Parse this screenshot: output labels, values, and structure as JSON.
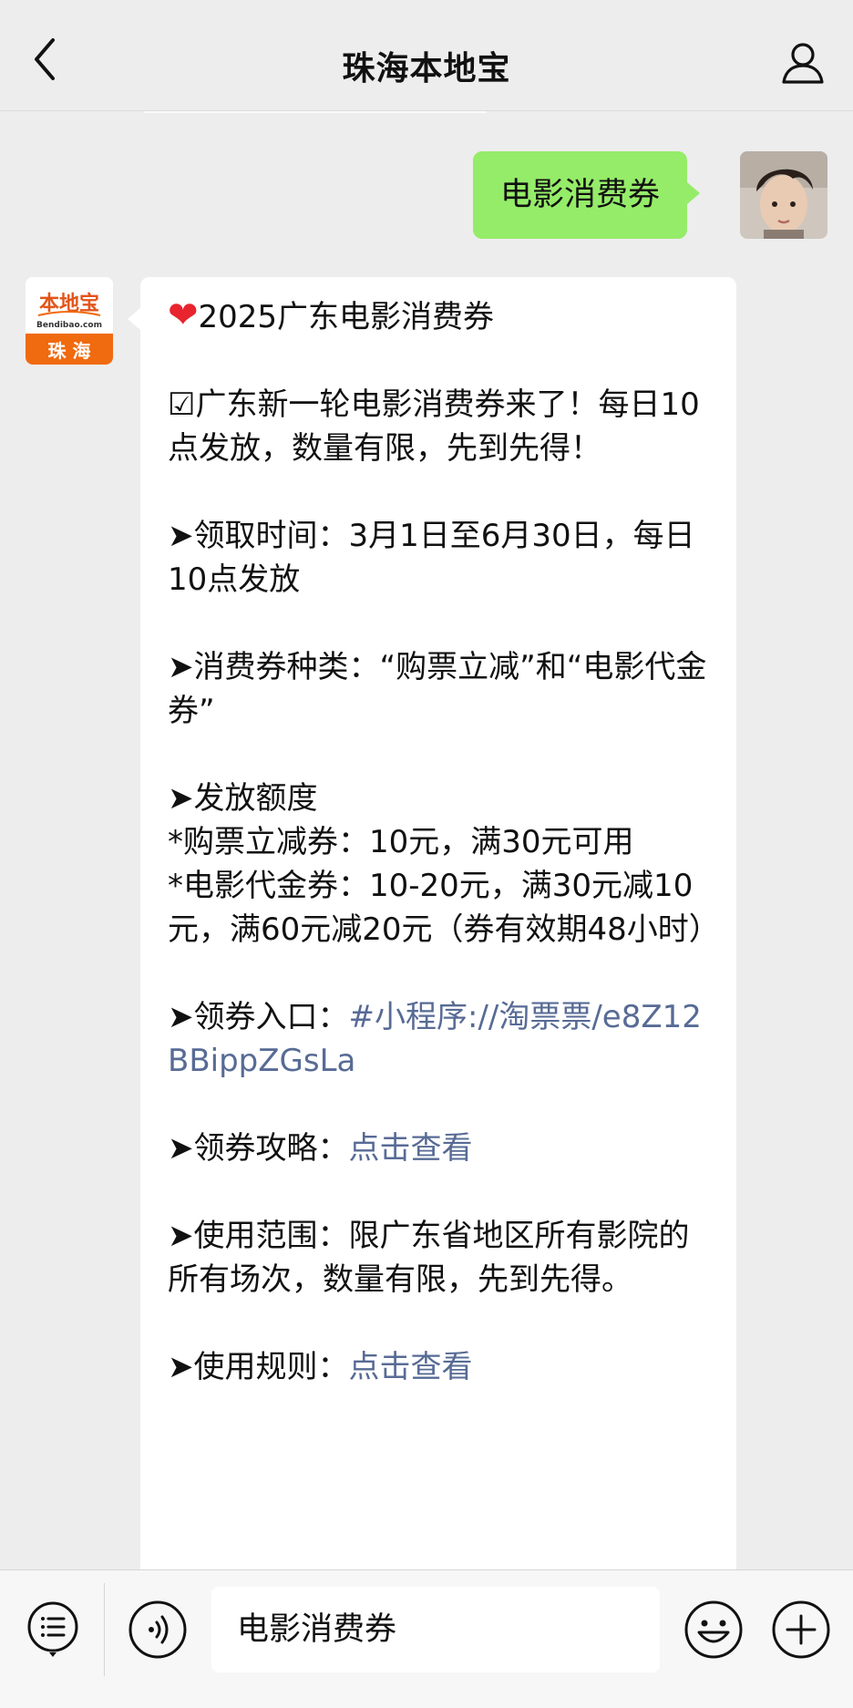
{
  "header": {
    "title": "珠海本地宝",
    "back_icon": "chevron-left-icon",
    "profile_icon": "person-icon"
  },
  "sent_message": {
    "text": "电影消费券"
  },
  "brand_avatar": {
    "logo_text": "本地宝",
    "site_text": "Bendibao.com",
    "city_text": "珠 海"
  },
  "received_message": {
    "title": "2025广东电影消费券",
    "intro": "☑广东新一轮电影消费券来了！每日10点发放，数量有限，先到先得！",
    "time": "➤领取时间：3月1日至6月30日，每日10点发放",
    "types": "➤消费券种类：“购票立减”和“电影代金券”",
    "amount_title": "➤发放额度",
    "amount_line1": "*购票立减券：10元，满30元可用",
    "amount_line2": "*电影代金券：10-20元，满30元减10元，满60元减20元（券有效期48小时）",
    "entry_label": "➤领券入口：",
    "entry_link": "#小程序://淘票票/e8Z12BBippZGsLa",
    "guide_label": "➤领券攻略：",
    "guide_link": "点击查看",
    "scope": "➤使用范围：限广东省地区所有影院的所有场次，数量有限，先到先得。",
    "rules_label": "➤使用规则：",
    "rules_link": "点击查看"
  },
  "input_bar": {
    "input_value": "电影消费券"
  },
  "colors": {
    "sent_bubble": "#95ec69",
    "link": "#576b95",
    "brand_orange": "#f06a0f"
  }
}
